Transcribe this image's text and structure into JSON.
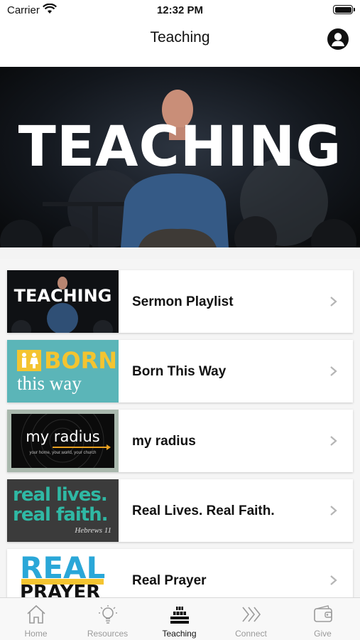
{
  "status": {
    "carrier": "Carrier",
    "time": "12:32 PM"
  },
  "nav": {
    "title": "Teaching"
  },
  "hero": {
    "title": "TEACHING"
  },
  "list": {
    "items": [
      {
        "label": "Sermon Playlist",
        "thumb_text": "TEACHING"
      },
      {
        "label": "Born This Way",
        "thumb_text_1": "BORN",
        "thumb_text_2": "this way"
      },
      {
        "label": "my radius",
        "thumb_text": "my radius",
        "thumb_sub": "your home, your world, your church"
      },
      {
        "label": "Real Lives. Real Faith.",
        "thumb_text_1": "real lives.",
        "thumb_text_2": "real faith.",
        "thumb_text_3": "Hebrews 11"
      },
      {
        "label": "Real Prayer",
        "thumb_text_1": "REAL",
        "thumb_text_2": "PRAYER"
      }
    ]
  },
  "tabs": [
    {
      "label": "Home",
      "icon": "home-icon"
    },
    {
      "label": "Resources",
      "icon": "lightbulb-icon"
    },
    {
      "label": "Teaching",
      "icon": "podium-icon",
      "active": true
    },
    {
      "label": "Connect",
      "icon": "chevrons-icon"
    },
    {
      "label": "Give",
      "icon": "wallet-icon"
    }
  ],
  "colors": {
    "accent_teal": "#5bb5b8",
    "accent_yellow": "#f4c430",
    "real_blue": "#2aa7d8",
    "text": "#111111",
    "tab_inactive": "#9a9a9a"
  }
}
